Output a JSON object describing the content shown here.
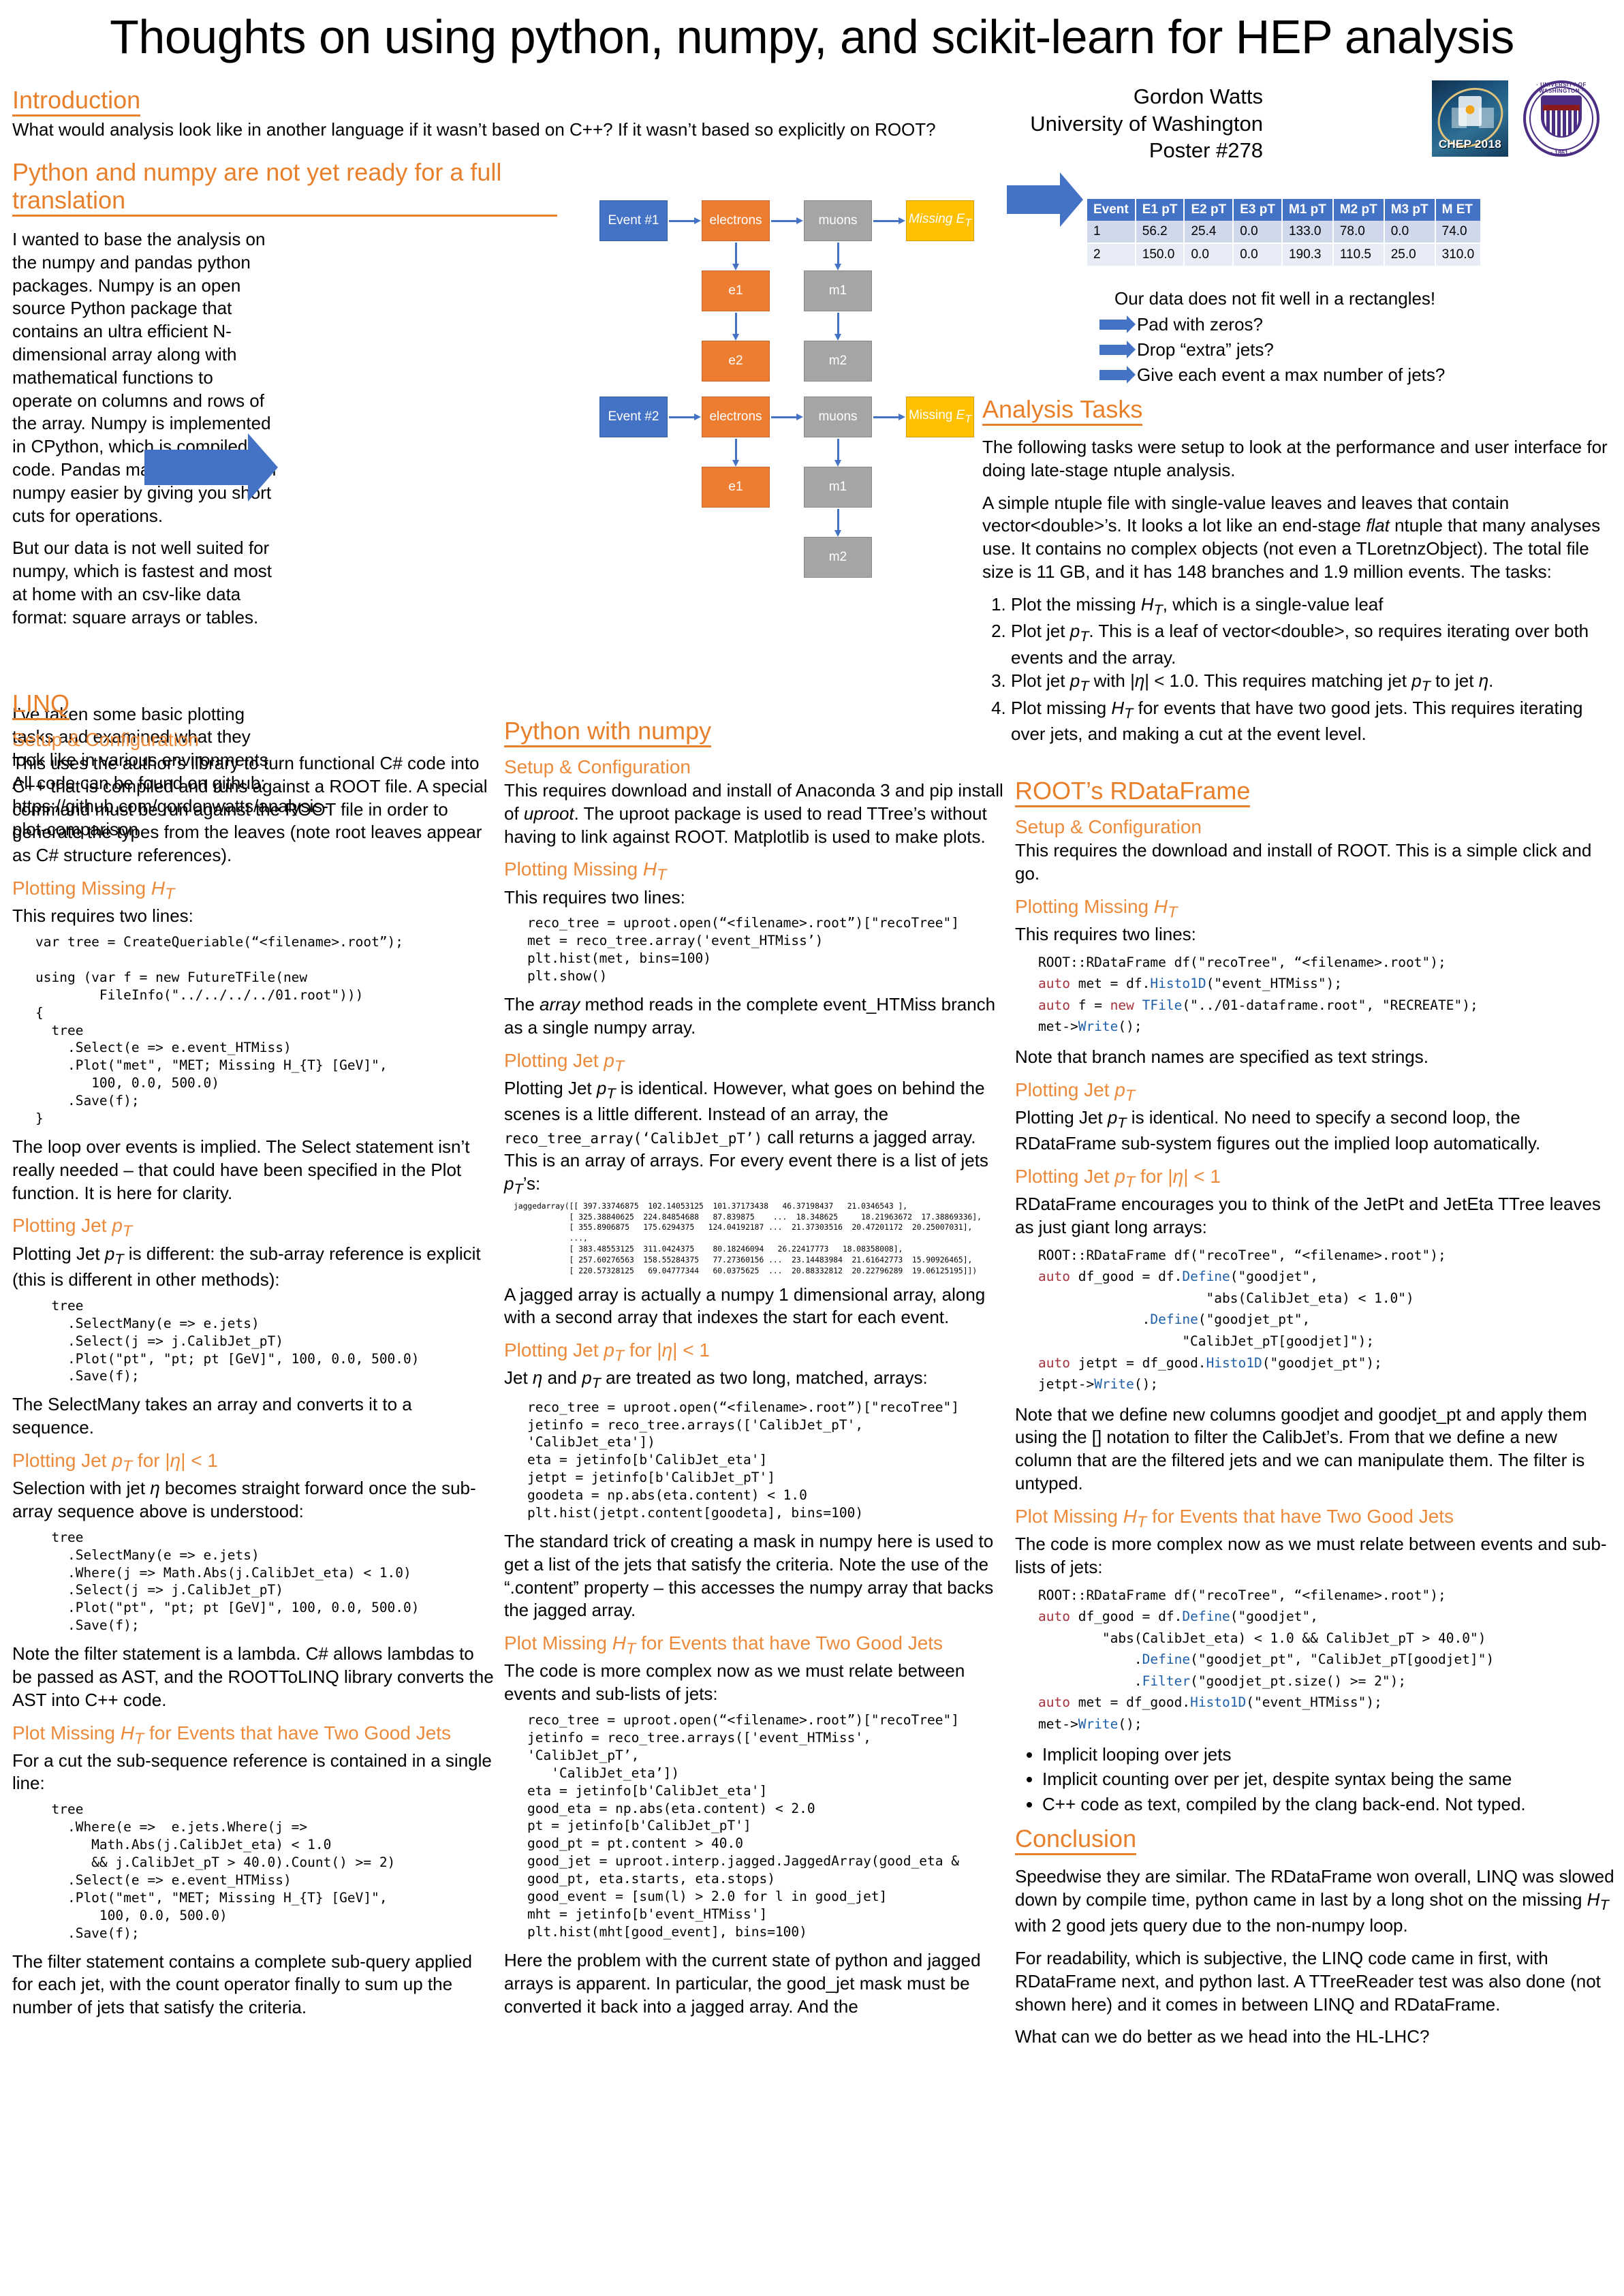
{
  "title": "Thoughts on using python, numpy, and scikit-learn for HEP analysis",
  "header": {
    "author": "Gordon Watts",
    "affiliation": "University of Washington",
    "poster_number": "Poster #278",
    "chep_logo_text": "CHEP 2018",
    "uw_logo_top": "· UNIVERSITY OF WASHINGTON ·",
    "uw_logo_year": "· 1861 ·"
  },
  "accent_color": "#e8802b",
  "intro": {
    "heading": "Introduction",
    "body": "What would analysis look like in another language if it wasn’t based on C++? If it wasn’t based so explicitly on ROOT?"
  },
  "numpy_section": {
    "heading": "Python and numpy are not yet ready for a full translation",
    "p1": "I wanted to base the analysis on the numpy and pandas python packages. Numpy is an open source Python package that contains an ultra efficient N-dimensional array along with mathematical functions to operate on columns and rows of the array. Numpy is implemented in CPython, which is compiled code. Pandas makes dealing with numpy easier by giving you short cuts for operations.",
    "p2": "But our data is not well suited for numpy, which is fastest and most at home with an csv-like data format: square arrays or tables.",
    "p3": "I’ve taken some basic plotting tasks and examined what they look like in various environments. All code can be found on github: https://github.com/gordonwatts/analysis-plot-comparison"
  },
  "diagram": {
    "event1": "Event #1",
    "event2": "Event #2",
    "electrons": "electrons",
    "muons": "muons",
    "missing_et": "Missing E_T",
    "e1": "e1",
    "e2": "e2",
    "m1": "m1",
    "m2": "m2"
  },
  "table": {
    "columns": [
      "Event",
      "E1 pT",
      "E2 pT",
      "E3 pT",
      "M1 pT",
      "M2 pT",
      "M3 pT",
      "M ET"
    ],
    "rows": [
      [
        "1",
        "56.2",
        "25.4",
        "0.0",
        "133.0",
        "78.0",
        "0.0",
        "74.0"
      ],
      [
        "2",
        "150.0",
        "0.0",
        "0.0",
        "190.3",
        "110.5",
        "25.0",
        "310.0"
      ]
    ]
  },
  "rect_notes": {
    "intro": "Our data does not fit well in a rectangles!",
    "items": [
      "Pad with zeros?",
      "Drop “extra” jets?",
      "Give each event a max number of jets?"
    ]
  },
  "analysis_tasks": {
    "heading": "Analysis Tasks",
    "p1": "The following tasks were setup to look at the performance and user interface for doing late-stage ntuple analysis.",
    "p2a": "A simple ntuple file with single-value leaves and leaves that contain vector<double>’s. It looks a lot like an end-stage ",
    "p2_italic": "flat",
    "p2b": " ntuple that many analyses use. It contains no complex objects (not even a TLoretnzObject). The total file size is 11 GB, and it has 148 branches and 1.9 million events. The tasks:",
    "tasks": [
      "Plot the missing H_T, which is a single-value leaf",
      "Plot jet p_T. This is a leaf of vector<double>, so requires iterating over both events and the array.",
      "Plot jet p_T with |η| < 1.0. This requires matching jet p_T to jet η.",
      "Plot missing H_T for events that have two good jets. This requires iterating over jets, and making a cut at the event level."
    ]
  },
  "linq": {
    "heading": "LINQ",
    "setup_heading": "Setup & Configuration",
    "setup_body": "This uses the author’s library to turn functional C# code into C++ that is compiled and runs against a ROOT file. A special command must be run against the ROOT file in order to generate the types from the leaves (note root leaves appear as C# structure references).",
    "h_met": "Plotting Missing H_T",
    "met_intro": "This requires two lines:",
    "met_code": "var tree = CreateQueriable(“<filename>.root”);\n\nusing (var f = new FutureTFile(new\n        FileInfo(\"../../../../01.root\")))\n{\n  tree\n    .Select(e => e.event_HTMiss)\n    .Plot(\"met\", \"MET; Missing H_{T} [GeV]\",\n       100, 0.0, 500.0)\n    .Save(f);\n}",
    "met_note": "The loop over events is implied. The Select statement isn’t really needed – that could have been specified in the Plot function. It is here for clarity.",
    "h_pt": "Plotting Jet p_T",
    "pt_intro": "Plotting Jet p_T is different: the sub-array reference is explicit (this is different in other methods):",
    "pt_code": "  tree\n    .SelectMany(e => e.jets)\n    .Select(j => j.CalibJet_pT)\n    .Plot(\"pt\", \"pt; pt [GeV]\", 100, 0.0, 500.0)\n    .Save(f);",
    "pt_note": "The SelectMany takes an array and converts it to a sequence.",
    "h_eta": "Plotting Jet p_T for |η| < 1",
    "eta_intro": "Selection with jet η becomes straight forward once the sub-array sequence above is understood:",
    "eta_code": "  tree\n    .SelectMany(e => e.jets)\n    .Where(j => Math.Abs(j.CalibJet_eta) < 1.0)\n    .Select(j => j.CalibJet_pT)\n    .Plot(\"pt\", \"pt; pt [GeV]\", 100, 0.0, 500.0)\n    .Save(f);",
    "eta_note": "Note the filter statement is a lambda. C# allows lambdas to be passed as AST, and the ROOTToLINQ library converts the AST into C++ code.",
    "h_two": "Plot Missing H_T for Events that have Two Good Jets",
    "two_intro": "For a cut the sub-sequence reference is contained in a single line:",
    "two_code": "  tree\n    .Where(e =>  e.jets.Where(j =>\n       Math.Abs(j.CalibJet_eta) < 1.0\n       && j.CalibJet_pT > 40.0).Count() >= 2)\n    .Select(e => e.event_HTMiss)\n    .Plot(\"met\", \"MET; Missing H_{T} [GeV]\",\n        100, 0.0, 500.0)\n    .Save(f);",
    "two_note": "The filter statement contains a complete sub-query applied for each jet, with the count operator finally to sum up the number of jets that satisfy the criteria."
  },
  "pynumpy": {
    "heading": "Python with numpy",
    "setup_heading": "Setup & Configuration",
    "setup_body_a": "This requires download and install of Anaconda 3 and pip install of ",
    "setup_body_italic": "uproot",
    "setup_body_b": ". The uproot package is used to read TTree’s without having to link against ROOT. Matplotlib is used to make plots.",
    "h_met": "Plotting Missing H_T",
    "met_intro": "This requires two lines:",
    "met_code": "reco_tree = uproot.open(“<filename>.root”)[\"recoTree\"]\nmet = reco_tree.array('event_HTMiss’)\nplt.hist(met, bins=100)\nplt.show()",
    "met_note_a": "The ",
    "met_note_italic": "array",
    "met_note_b": " method reads in the complete event_HTMiss branch as a single numpy array.",
    "h_pt": "Plotting Jet p_T",
    "pt_note1": "Plotting Jet p_T is identical. However, what goes on behind the scenes is a little different. Instead of an array, the",
    "pt_code_inline": "reco_tree_array(‘CalibJet_pT’)",
    "pt_note2": "call returns a jagged array. This is an array of arrays. For every event there is a list of jets p_T’s:",
    "jagged": "jaggedarray([[ 397.33746875  102.14053125  101.37173438   46.37198437   21.0346543 ],\n            [ 325.38840625  224.84854688   87.839875    ...  18.348625     18.21963672  17.38869336],\n            [ 355.8906875   175.6294375   124.04192187 ...  21.37303516  20.47201172  20.25007031],\n            ...,\n            [ 383.48553125  311.0424375    80.18246094   26.22417773   18.08358008],\n            [ 257.60276563  158.55284375   77.27360156 ...  23.14483984  21.61642773  15.90926465],\n            [ 220.57328125   69.04777344   60.0375625  ...  20.88332812  20.22796289  19.06125195]])",
    "jagged_note": "A jagged array is actually a numpy 1 dimensional array, along with a second array that indexes the start for each event.",
    "h_eta": "Plotting Jet p_T for |η| < 1",
    "eta_intro": "Jet η and p_T are treated as two long, matched, arrays:",
    "eta_code": "reco_tree = uproot.open(“<filename>.root”)[\"recoTree\"]\njetinfo = reco_tree.arrays(['CalibJet_pT',\n'CalibJet_eta'])\neta = jetinfo[b'CalibJet_eta']\njetpt = jetinfo[b'CalibJet_pT']\ngoodeta = np.abs(eta.content) < 1.0\nplt.hist(jetpt.content[goodeta], bins=100)",
    "eta_note": "The standard trick of creating a mask in numpy here is used to get a list of the jets that satisfy the criteria. Note the use of the “.content”  property – this accesses the numpy array that backs the jagged array.",
    "h_two": "Plot Missing H_T for Events that have Two Good Jets",
    "two_intro": "The code is more complex now as we must relate between events and sub-lists of jets:",
    "two_code": "reco_tree = uproot.open(“<filename>.root”)[\"recoTree\"]\njetinfo = reco_tree.arrays(['event_HTMiss',\n'CalibJet_pT’,\n   'CalibJet_eta’])\neta = jetinfo[b'CalibJet_eta']\ngood_eta = np.abs(eta.content) < 2.0\npt = jetinfo[b'CalibJet_pT']\ngood_pt = pt.content > 40.0\ngood_jet = uproot.interp.jagged.JaggedArray(good_eta &\ngood_pt, eta.starts, eta.stops)\ngood_event = [sum(l) > 2.0 for l in good_jet]\nmht = jetinfo[b'event_HTMiss']\nplt.hist(mht[good_event], bins=100)",
    "two_note": "Here the problem with the current state of python and jagged arrays is apparent. In particular, the good_jet mask must be converted it back into a jagged array. And the"
  },
  "rdf": {
    "heading": "ROOT’s RDataFrame",
    "setup_heading": "Setup & Configuration",
    "setup_body": "This requires the download and install of ROOT. This is a simple click and go.",
    "h_met": "Plotting Missing H_T",
    "met_intro": "This requires two lines:",
    "met_code_lines": [
      {
        "pre": "ROOT::RDataFrame df(\"recoTree\", “<filename>.root\");"
      },
      {
        "kw": "auto",
        "mid": " met = df.",
        "fn": "Histo1D",
        "post": "(\"event_HTMiss\");"
      },
      {
        "kw": "auto",
        "mid": " f = ",
        "kw2": "new",
        "fn": " TFile",
        "post": "(\"../01-dataframe.root\", \"RECREATE\");"
      },
      {
        "pre2": "met->",
        "fn": "Write",
        "post": "();"
      }
    ],
    "met_note": "Note that branch names are specified as text strings.",
    "h_pt": "Plotting Jet p_T",
    "pt_note": "Plotting Jet p_T is identical. No need to specify a second loop, the RDataFrame sub-system figures out the implied loop automatically.",
    "h_eta": "Plotting Jet p_T for |η| < 1",
    "eta_intro": "RDataFrame encourages you to think of the JetPt and JetEta TTree leaves as just giant long arrays:",
    "eta_note": "Note that we define new columns goodjet and goodjet_pt and apply them using the [] notation to filter the CalibJet’s. From that we define a new column that are the filtered jets and we can manipulate them. The filter is untyped.",
    "h_two": "Plot Missing H_T for Events that have Two Good Jets",
    "two_intro": "The code is more complex now as we must relate between events and sub-lists of jets:",
    "bullets": [
      "Implicit looping over jets",
      "Implicit counting over per jet, despite syntax being the same",
      "C++ code as text, compiled by the clang back-end. Not typed."
    ]
  },
  "conclusion": {
    "heading": "Conclusion",
    "p1": "Speedwise they are similar. The RDataFrame won overall, LINQ was slowed down by compile time, python came in last by a long shot on the missing H_T with 2 good jets query due to the non-numpy loop.",
    "p2": "For readability, which is subjective, the LINQ code came in first, with RDataFrame next, and python last. A TTreeReader test was also done (not shown here) and it comes in between LINQ and RDataFrame.",
    "p3": "What can we do better as we head into the HL-LHC?"
  }
}
